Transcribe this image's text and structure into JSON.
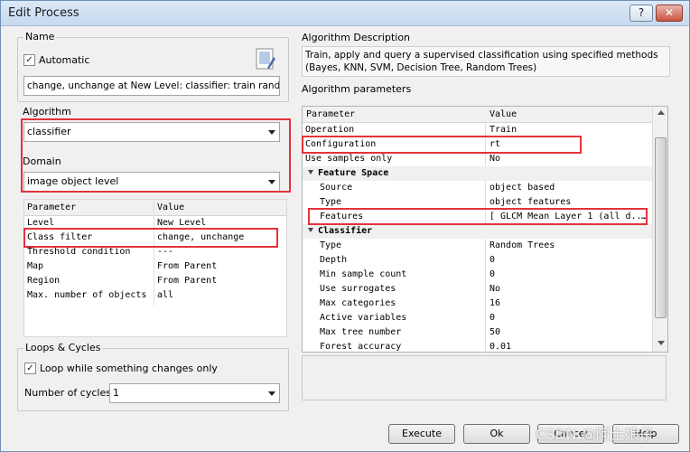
{
  "window": {
    "title": "Edit Process",
    "help_label": "?",
    "close_label": "✕"
  },
  "name_group": {
    "label": "Name",
    "automatic_label": "Automatic",
    "automatic_checked": "✓",
    "name_value": "change, unchange at  New Level: classifier: train random tre"
  },
  "algorithm": {
    "label": "Algorithm",
    "value": "classifier"
  },
  "domain": {
    "label": "Domain",
    "value": "image object level",
    "headers": [
      "Parameter",
      "Value"
    ],
    "rows": [
      {
        "p": "Level",
        "v": "New Level"
      },
      {
        "p": "Class filter",
        "v": "change, unchange"
      },
      {
        "p": "Threshold condition",
        "v": "---"
      },
      {
        "p": "Map",
        "v": "From Parent"
      },
      {
        "p": "Region",
        "v": "From Parent"
      },
      {
        "p": "Max. number of objects",
        "v": "all"
      }
    ]
  },
  "loops": {
    "label": "Loops & Cycles",
    "loop_label": "Loop while something changes only",
    "loop_checked": "✓",
    "cycles_label": "Number of cycles",
    "cycles_value": "1"
  },
  "description": {
    "label": "Algorithm Description",
    "text": "Train, apply and query a supervised classification using specified methods (Bayes, KNN, SVM, Decision Tree, Random Trees)"
  },
  "params": {
    "label": "Algorithm parameters",
    "headers": [
      "Parameter",
      "Value"
    ],
    "rows": [
      {
        "p": "Operation",
        "v": "Train"
      },
      {
        "p": "Configuration",
        "v": "rt"
      },
      {
        "p": "Use samples only",
        "v": "No"
      },
      {
        "cat": "Feature Space"
      },
      {
        "p": "Source",
        "v": "object based"
      },
      {
        "p": "Type",
        "v": "object features"
      },
      {
        "p": "Features",
        "v": "[ GLCM Mean Layer 1 (all d..."
      },
      {
        "cat": "Classifier"
      },
      {
        "p": "Type",
        "v": "Random Trees"
      },
      {
        "p": "Depth",
        "v": "0"
      },
      {
        "p": "Min sample count",
        "v": "0"
      },
      {
        "p": "Use surrogates",
        "v": "No"
      },
      {
        "p": "Max categories",
        "v": "16"
      },
      {
        "p": "Active variables",
        "v": "0"
      },
      {
        "p": "Max tree number",
        "v": "50"
      },
      {
        "p": "Forest accuracy",
        "v": "0.01"
      }
    ],
    "features_dots": "…"
  },
  "buttons": {
    "execute": "Execute",
    "ok": "Ok",
    "cancel": "Cancel",
    "help": "Help"
  },
  "watermark": "CSDN @阿土娘子"
}
